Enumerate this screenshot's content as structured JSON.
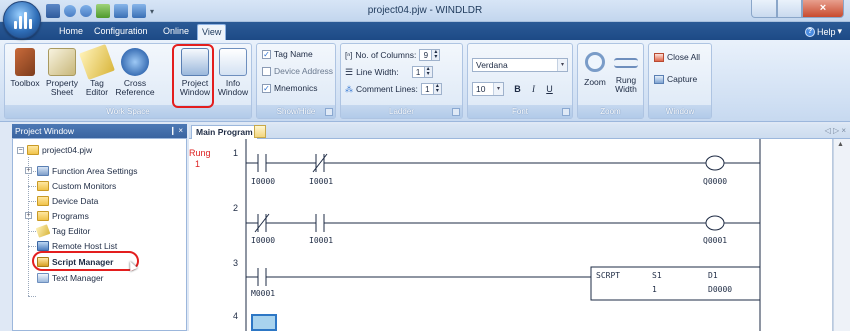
{
  "window": {
    "title": "project04.pjw - WINDLDR"
  },
  "tabs": [
    {
      "label": "Home",
      "active": false
    },
    {
      "label": "Configuration",
      "active": false
    },
    {
      "label": "Online",
      "active": false
    },
    {
      "label": "View",
      "active": true
    }
  ],
  "help_label": "Help",
  "ribbon": {
    "workspace": {
      "label": "Work Space",
      "buttons": [
        {
          "line1": "Toolbox",
          "line2": ""
        },
        {
          "line1": "Property",
          "line2": "Sheet"
        },
        {
          "line1": "Tag",
          "line2": "Editor"
        },
        {
          "line1": "Cross",
          "line2": "Reference"
        },
        {
          "line1": "Project",
          "line2": "Window"
        },
        {
          "line1": "Info",
          "line2": "Window"
        }
      ]
    },
    "showhide": {
      "label": "Show/Hide",
      "items": [
        {
          "label": "Tag Name",
          "checked": true
        },
        {
          "label": "Device Address",
          "checked": false
        },
        {
          "label": "Mnemonics",
          "checked": true
        }
      ]
    },
    "ladder": {
      "label": "Ladder",
      "columns_label": "No. of Columns:",
      "columns_value": "9",
      "line_width_label": "Line Width:",
      "line_width_value": "1",
      "comment_lines_label": "Comment Lines:",
      "comment_lines_value": "1"
    },
    "font": {
      "label": "Font",
      "family": "Verdana",
      "size": "10",
      "bold": "B",
      "italic": "I",
      "underline": "U"
    },
    "zoom": {
      "label": "Zoom",
      "buttons": [
        {
          "line1": "Zoom",
          "line2": ""
        },
        {
          "line1": "Rung",
          "line2": "Width"
        }
      ]
    },
    "window_group": {
      "label": "Window",
      "close_all": "Close All",
      "capture": "Capture"
    }
  },
  "project_window": {
    "title": "Project Window",
    "controls": "❙ ×",
    "tree": [
      {
        "label": "project04.pjw"
      },
      {
        "label": "Function Area Settings"
      },
      {
        "label": "Custom Monitors"
      },
      {
        "label": "Device Data"
      },
      {
        "label": "Programs"
      },
      {
        "label": "Tag Editor"
      },
      {
        "label": "Remote Host List"
      },
      {
        "label": "Script Manager"
      },
      {
        "label": "Text Manager"
      }
    ]
  },
  "document": {
    "tab_label": "Main Program",
    "nav": "◁ ▷ ×"
  },
  "ladder_program": {
    "rung_label": "Rung",
    "rung_index": "1",
    "rungs": [
      {
        "number": "1",
        "contacts": [
          "I0000",
          "I0001"
        ],
        "coil": "Q0000"
      },
      {
        "number": "2",
        "contacts": [
          "I0000",
          "I0001"
        ],
        "coil": "Q0001"
      },
      {
        "number": "3",
        "contacts": [
          "M0001"
        ],
        "instruction": {
          "name": "SCRPT",
          "s1_label": "S1",
          "s1_value": "1",
          "d1_label": "D1",
          "d1_value": "D0000"
        }
      },
      {
        "number": "4"
      }
    ]
  },
  "colors": {
    "accent": "#1d4a86",
    "highlight_red": "#e31e1e",
    "rung_label": "#dd2222",
    "selection_fill": "#a8d3ee"
  }
}
